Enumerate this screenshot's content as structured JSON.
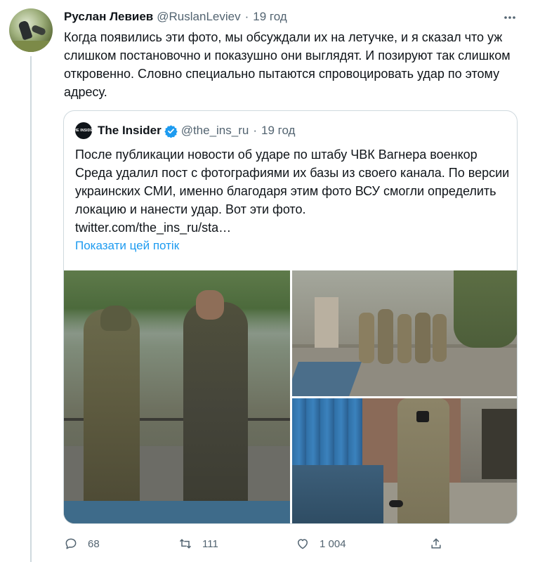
{
  "tweet": {
    "author_name": "Руслан Левиев",
    "author_handle": "@RuslanLeviev",
    "separator": "·",
    "time": "19 год",
    "more_icon": "more-horizontal-icon",
    "text": "Когда появились эти фото, мы обсуждали их на летучке, и я сказал что уж слишком постановочно и показушно они выглядят. И позируют так слишком откровенно. Словно специально пытаются спровоцировать удар по этому адресу."
  },
  "quote": {
    "avatar_text": "THE INSIDER",
    "author_name": "The Insider",
    "verified_icon": "verified-badge-icon",
    "author_handle": "@the_ins_ru",
    "separator": "·",
    "time": "19 год",
    "text": "После публикации новости об ударе по штабу ЧВК Вагнера военкор Среда удалил пост с фотографиями их базы из своего канала. По версии украинских СМИ, именно благодаря этим фото ВСУ смогли определить локацию и нанести удар. Вот эти фото.\ntwitter.com/the_ins_ru/sta…",
    "thread_link": "Показати цей потік"
  },
  "actions": {
    "reply_count": "68",
    "retweet_count": "111",
    "like_count": "1 004"
  },
  "colors": {
    "accent": "#1d9bf0",
    "secondary_text": "#536471",
    "border": "#cfd9de"
  }
}
